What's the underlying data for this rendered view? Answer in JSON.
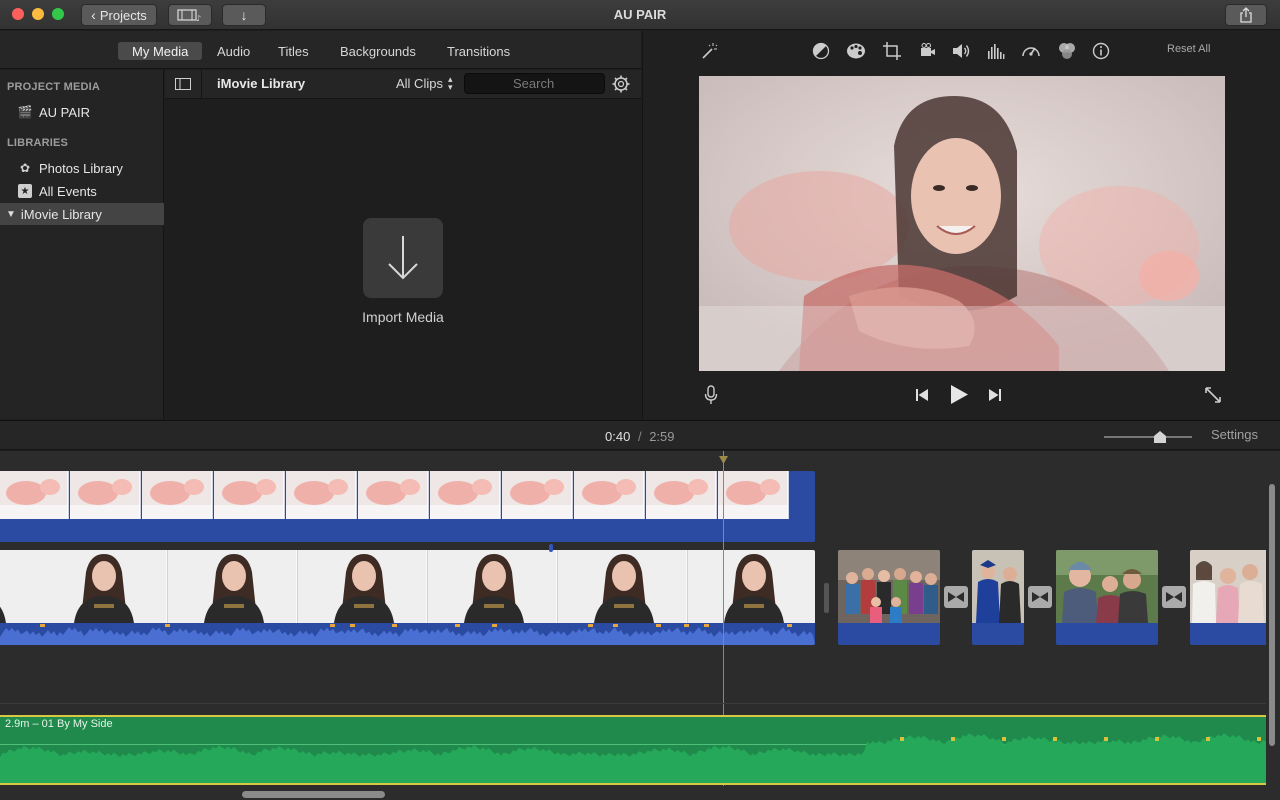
{
  "window": {
    "title": "AU PAIR",
    "back_button": "Projects",
    "traffic_colors": [
      "#fc605c",
      "#fdbc40",
      "#34c84a"
    ]
  },
  "media_tabs": [
    {
      "label": "My Media",
      "active": true
    },
    {
      "label": "Audio",
      "active": false
    },
    {
      "label": "Titles",
      "active": false
    },
    {
      "label": "Backgrounds",
      "active": false
    },
    {
      "label": "Transitions",
      "active": false
    }
  ],
  "sidebar": {
    "project_header": "PROJECT MEDIA",
    "project_item": "AU PAIR",
    "libraries_header": "LIBRARIES",
    "items": [
      {
        "label": "Photos Library",
        "icon": "photos-icon"
      },
      {
        "label": "All Events",
        "icon": "star-icon"
      },
      {
        "label": "iMovie Library",
        "icon": "disclosure-triangle-icon",
        "selected": true
      }
    ]
  },
  "browser": {
    "library_title": "iMovie Library",
    "filter": "All Clips",
    "search_placeholder": "Search",
    "import_label": "Import Media"
  },
  "viewer": {
    "reset_all": "Reset All",
    "tools": [
      "magic-wand-icon",
      "color-balance-icon",
      "color-correction-icon",
      "crop-icon",
      "stabilization-icon",
      "volume-icon",
      "equalizer-icon",
      "speed-icon",
      "filter-icon",
      "info-icon"
    ]
  },
  "timeline": {
    "current_time": "0:40",
    "separator": "/",
    "total_time": "2:59",
    "settings_label": "Settings",
    "music_track_label": "2.9m – 01 By My Side",
    "accent_blue": "#2b4aa2",
    "music_green": "#1f8a4c"
  }
}
